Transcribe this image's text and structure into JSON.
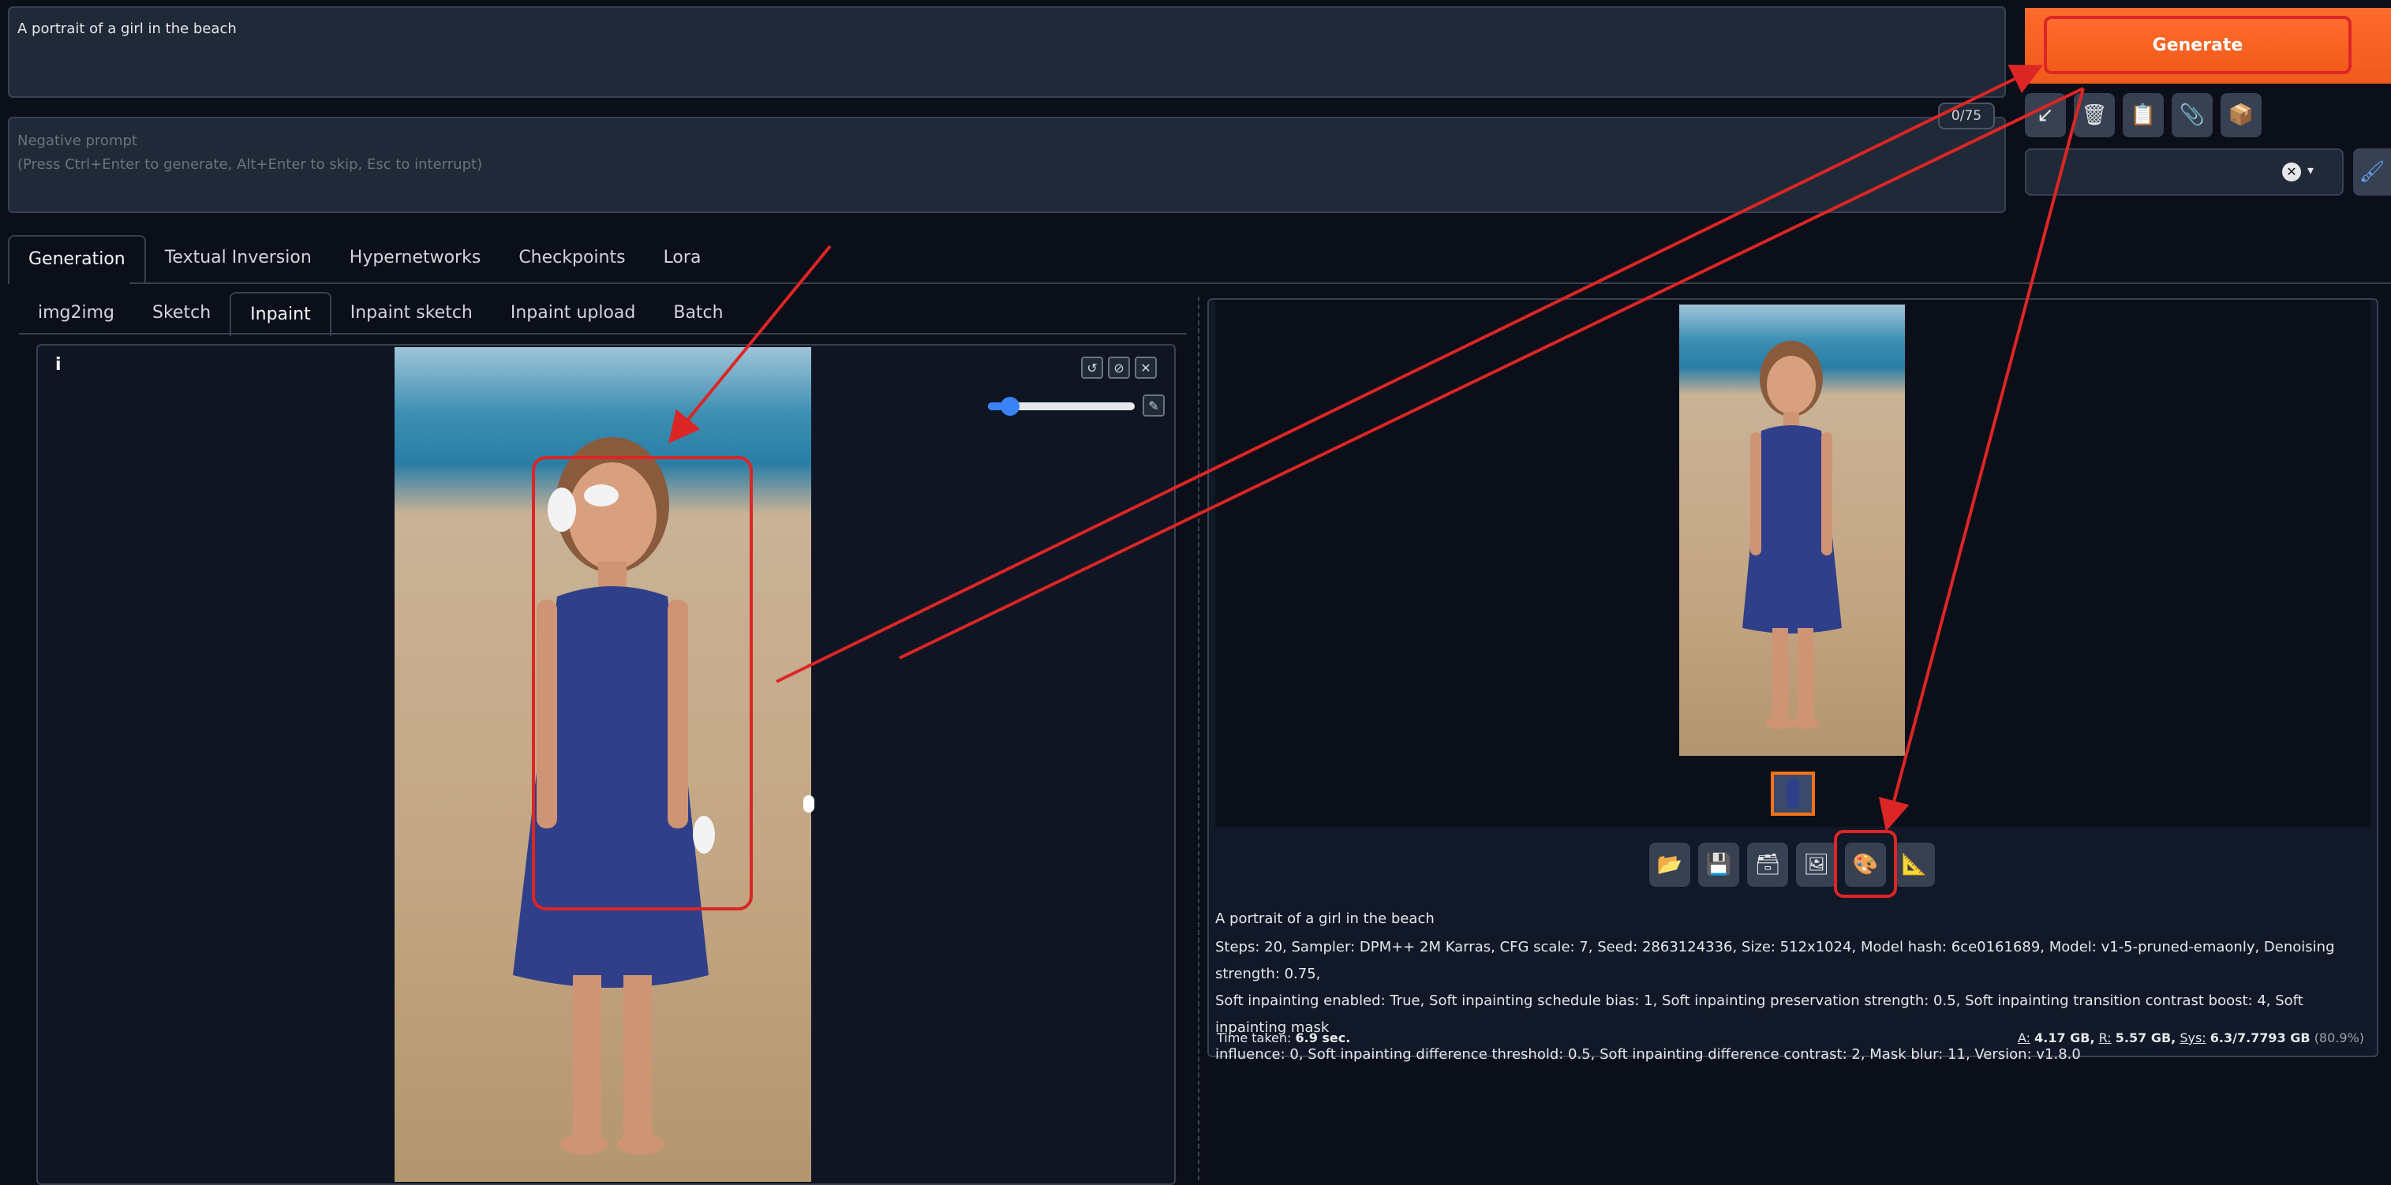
{
  "prompt": {
    "value": "A portrait of a girl in the beach"
  },
  "negative_prompt": {
    "placeholder_line1": "Negative prompt",
    "placeholder_line2": "(Press Ctrl+Enter to generate, Alt+Enter to skip, Esc to interrupt)",
    "token_count": "0/75"
  },
  "generate": {
    "label": "Generate"
  },
  "toolbar_icons": [
    "arrow-down-left-icon",
    "trash-icon",
    "clipboard-icon",
    "paperclip-icon",
    "package-icon"
  ],
  "main_tabs": [
    "Generation",
    "Textual Inversion",
    "Hypernetworks",
    "Checkpoints",
    "Lora"
  ],
  "sub_tabs": [
    "img2img",
    "Sketch",
    "Inpaint",
    "Inpaint sketch",
    "Inpaint upload",
    "Batch"
  ],
  "canvas": {
    "info_label": "i",
    "brush_size_pct": 10
  },
  "result": {
    "prompt": "A portrait of a girl in the beach",
    "params_line1": "Steps: 20, Sampler: DPM++ 2M Karras, CFG scale: 7, Seed: 2863124336, Size: 512x1024, Model hash: 6ce0161689, Model: v1-5-pruned-emaonly, Denoising strength: 0.75,",
    "params_line2": "Soft inpainting enabled: True, Soft inpainting schedule bias: 1, Soft inpainting preservation strength: 0.5, Soft inpainting transition contrast boost: 4, Soft inpainting mask",
    "params_line3": "influence: 0, Soft inpainting difference threshold: 0.5, Soft inpainting difference contrast: 2, Mask blur: 11, Version: v1.8.0",
    "time_label": "Time taken:",
    "time_value": "6.9 sec.",
    "mem_a_label": "A:",
    "mem_a": "4.17 GB,",
    "mem_r_label": "R:",
    "mem_r": "5.57 GB,",
    "mem_sys_label": "Sys:",
    "mem_sys": "6.3/7.7793 GB",
    "mem_pct": "(80.9%)"
  },
  "colors": {
    "accent": "#f25a1a",
    "annotation": "#dc2626",
    "bg": "#0b0f19"
  }
}
